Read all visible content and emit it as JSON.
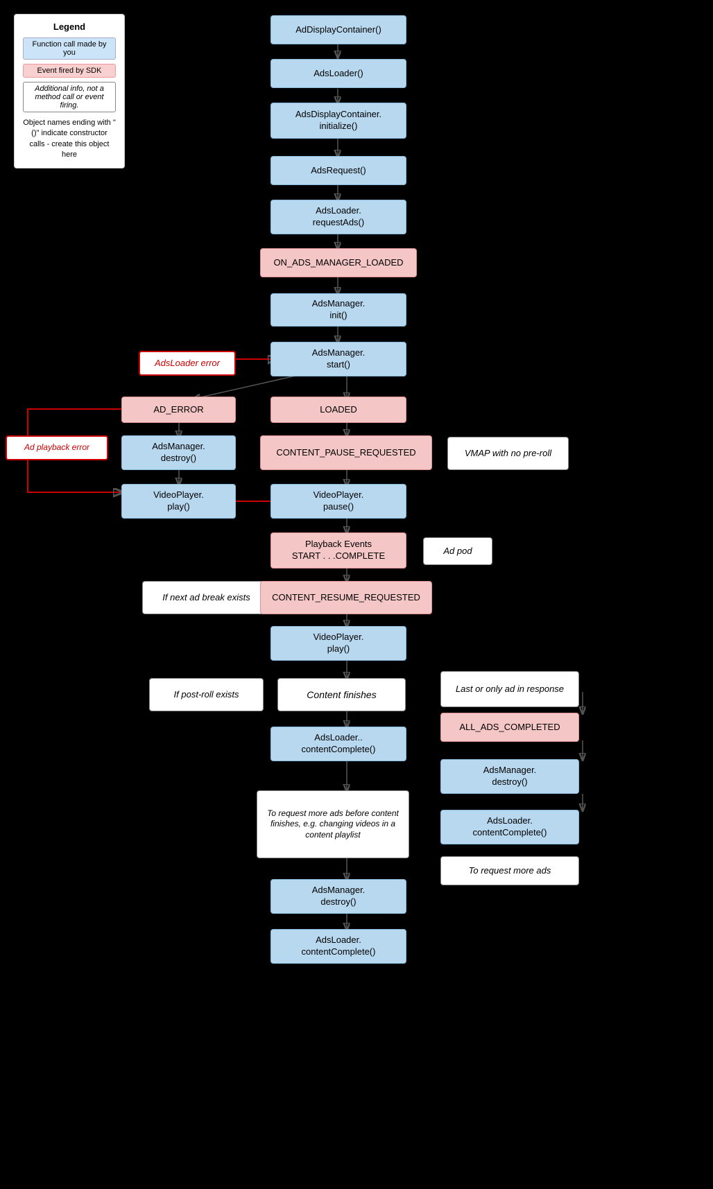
{
  "legend": {
    "title": "Legend",
    "items": [
      {
        "label": "Function call made by you",
        "type": "blue"
      },
      {
        "label": "Event fired by SDK",
        "type": "pink"
      },
      {
        "label": "Additional info, not a method call or event firing.",
        "type": "italic"
      }
    ],
    "note": "Object names ending with \"()\" indicate constructor calls - create this object here"
  },
  "nodes": {
    "adDisplayContainer": "AdDisplayContainer()",
    "adsLoader": "AdsLoader()",
    "adsDisplayContainerInit": "AdsDisplayContainer.\ninitialize()",
    "adsRequest": "AdsRequest()",
    "adsLoaderRequestAds": "AdsLoader.\nrequestAds()",
    "onAdsManagerLoaded": "ON_ADS_MANAGER_LOADED",
    "adsManagerInit": "AdsManager.\ninit()",
    "adsLoaderError": "AdsLoader error",
    "adsManagerStart": "AdsManager.\nstart()",
    "adError": "AD_ERROR",
    "loaded": "LOADED",
    "adPlaybackError": "Ad playback error",
    "contentPauseRequested": "CONTENT_PAUSE_REQUESTED",
    "vmapNoPreroll": "VMAP with no pre-roll",
    "adsManagerDestroy1": "AdsManager.\ndestroy()",
    "videoPlayerPlay1": "VideoPlayer.\nplay()",
    "videoPlayerPause": "VideoPlayer.\npause()",
    "playbackEvents": "Playback Events\nSTART . . .COMPLETE",
    "adPod": "Ad pod",
    "ifNextAdBreak": "If next ad break exists",
    "contentResumeRequested": "CONTENT_RESUME_REQUESTED",
    "videoPlayerPlay2": "VideoPlayer.\nplay()",
    "ifPostRollExists": "If post-roll exists",
    "contentFinishes": "Content finishes",
    "lastOrOnlyAd": "Last or only ad in response",
    "allAdsCompleted": "ALL_ADS_COMPLETED",
    "adsLoaderContentComplete1": "AdsLoader..\ncontentComplete()",
    "adsManagerDestroy2": "AdsManager.\ndestroy()",
    "adsLoaderContentComplete2": "AdsLoader.\ncontentComplete()",
    "toRequestMoreAdsNote": "To request more ads before content finishes, e.g. changing videos in a content playlist",
    "toRequestMoreAds": "To request more ads",
    "adsManagerDestroy3": "AdsManager.\ndestroy()",
    "adsLoaderContentComplete3": "AdsLoader.\ncontentComplete()"
  }
}
